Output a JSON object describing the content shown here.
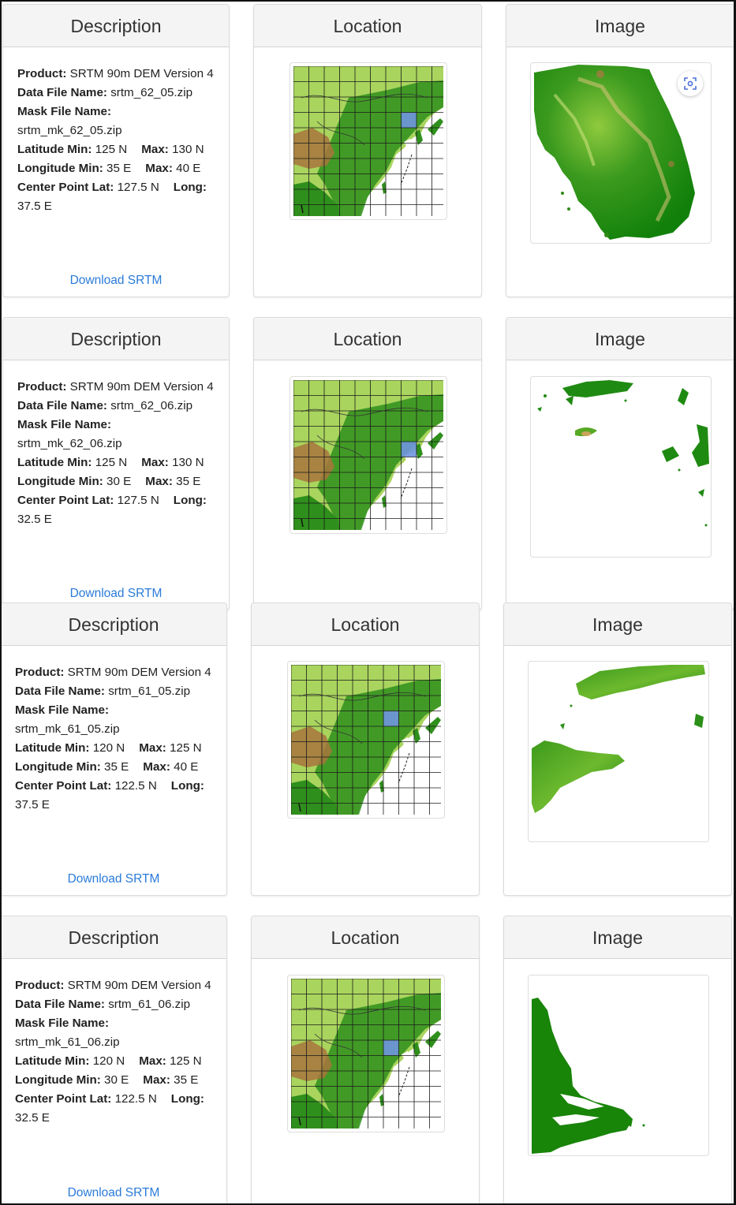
{
  "headers": {
    "description": "Description",
    "location": "Location",
    "image": "Image"
  },
  "labels": {
    "product": "Product:",
    "data_file": "Data File Name:",
    "mask_file": "Mask File Name:",
    "lat_min": "Latitude Min:",
    "lon_min": "Longitude Min:",
    "max": "Max:",
    "center_lat": "Center Point Lat:",
    "long": "Long:"
  },
  "tiles": [
    {
      "product": "SRTM 90m DEM Version 4",
      "data_file": "srtm_62_05.zip",
      "mask_file": "srtm_mk_62_05.zip",
      "lat_min": "125 N",
      "lat_max": "130 N",
      "lon_min": "35 E",
      "lon_max": "40 E",
      "center_lat": "127.5 N",
      "center_long": "37.5 E",
      "download": "Download SRTM",
      "highlight_cell": "korea-north"
    },
    {
      "product": "SRTM 90m DEM Version 4",
      "data_file": "srtm_62_06.zip",
      "mask_file": "srtm_mk_62_06.zip",
      "lat_min": "125 N",
      "lat_max": "130 N",
      "lon_min": "30 E",
      "lon_max": "35 E",
      "center_lat": "127.5 N",
      "center_long": "32.5 E",
      "download": "Download SRTM",
      "highlight_cell": "korea-south"
    },
    {
      "product": "SRTM 90m DEM Version 4",
      "data_file": "srtm_61_05.zip",
      "mask_file": "srtm_mk_61_05.zip",
      "lat_min": "120 N",
      "lat_max": "125 N",
      "lon_min": "35 E",
      "lon_max": "40 E",
      "center_lat": "122.5 N",
      "center_long": "37.5 E",
      "download": "Download SRTM",
      "highlight_cell": "bohai"
    },
    {
      "product": "SRTM 90m DEM Version 4",
      "data_file": "srtm_61_06.zip",
      "mask_file": "srtm_mk_61_06.zip",
      "lat_min": "120 N",
      "lat_max": "125 N",
      "lon_min": "30 E",
      "lon_max": "35 E",
      "center_lat": "122.5 N",
      "center_long": "32.5 E",
      "download": "Download SRTM",
      "highlight_cell": "yellow-sea"
    }
  ],
  "icons": {
    "zoom": "focus-zoom-icon"
  },
  "colors": {
    "link": "#2a7bd8",
    "highlight": "#6f95e0",
    "terrain_green": "#2f8f1c",
    "terrain_light": "#a9d45e",
    "terrain_brown": "#a8743d"
  }
}
